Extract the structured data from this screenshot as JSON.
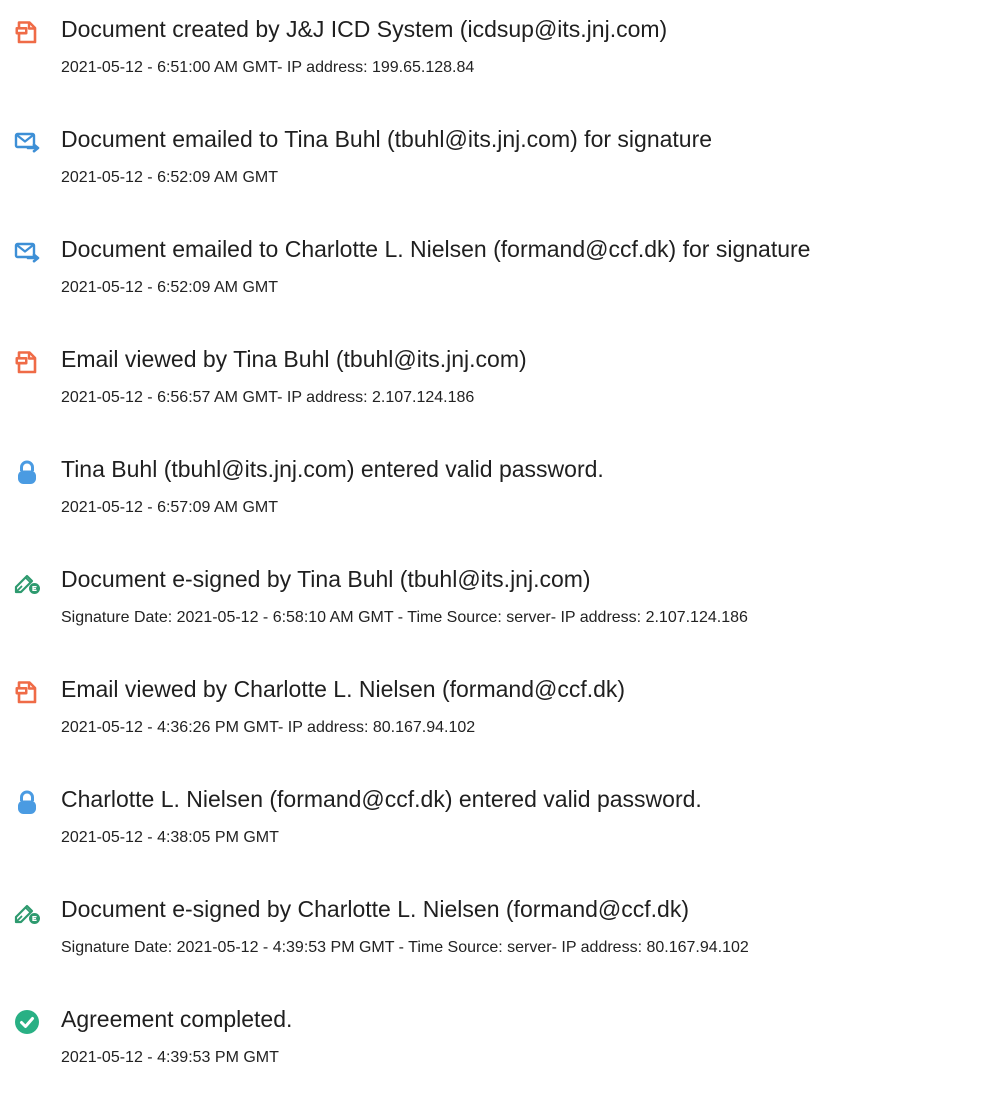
{
  "colors": {
    "doc_icon": "#ef6b47",
    "email_icon": "#3d8fd6",
    "lock_icon": "#4a9be2",
    "sign_icon": "#2e9a6f",
    "check_icon": "#29b084"
  },
  "events": [
    {
      "icon": "document-icon",
      "title": "Document created by J&J ICD System (icdsup@its.jnj.com)",
      "detail": "2021-05-12 - 6:51:00 AM GMT- IP address: 199.65.128.84"
    },
    {
      "icon": "email-icon",
      "title": "Document emailed to Tina Buhl (tbuhl@its.jnj.com) for signature",
      "detail": "2021-05-12 - 6:52:09 AM GMT"
    },
    {
      "icon": "email-icon",
      "title": "Document emailed to Charlotte L. Nielsen (formand@ccf.dk) for signature",
      "detail": "2021-05-12 - 6:52:09 AM GMT"
    },
    {
      "icon": "document-icon",
      "title": "Email viewed by Tina Buhl (tbuhl@its.jnj.com)",
      "detail": "2021-05-12 - 6:56:57 AM GMT- IP address: 2.107.124.186"
    },
    {
      "icon": "lock-icon",
      "title": "Tina Buhl (tbuhl@its.jnj.com) entered valid password.",
      "detail": "2021-05-12 - 6:57:09 AM GMT"
    },
    {
      "icon": "e-sign-icon",
      "title": "Document e-signed by Tina Buhl (tbuhl@its.jnj.com)",
      "detail": "Signature Date: 2021-05-12 - 6:58:10 AM GMT - Time Source: server- IP address: 2.107.124.186"
    },
    {
      "icon": "document-icon",
      "title": "Email viewed by Charlotte L. Nielsen (formand@ccf.dk)",
      "detail": "2021-05-12 - 4:36:26 PM GMT- IP address: 80.167.94.102"
    },
    {
      "icon": "lock-icon",
      "title": "Charlotte L. Nielsen (formand@ccf.dk) entered valid password.",
      "detail": "2021-05-12 - 4:38:05 PM GMT"
    },
    {
      "icon": "e-sign-icon",
      "title": "Document e-signed by Charlotte L. Nielsen (formand@ccf.dk)",
      "detail": "Signature Date: 2021-05-12 - 4:39:53 PM GMT - Time Source: server- IP address: 80.167.94.102"
    },
    {
      "icon": "check-circle-icon",
      "title": "Agreement completed.",
      "detail": "2021-05-12 - 4:39:53 PM GMT"
    }
  ]
}
